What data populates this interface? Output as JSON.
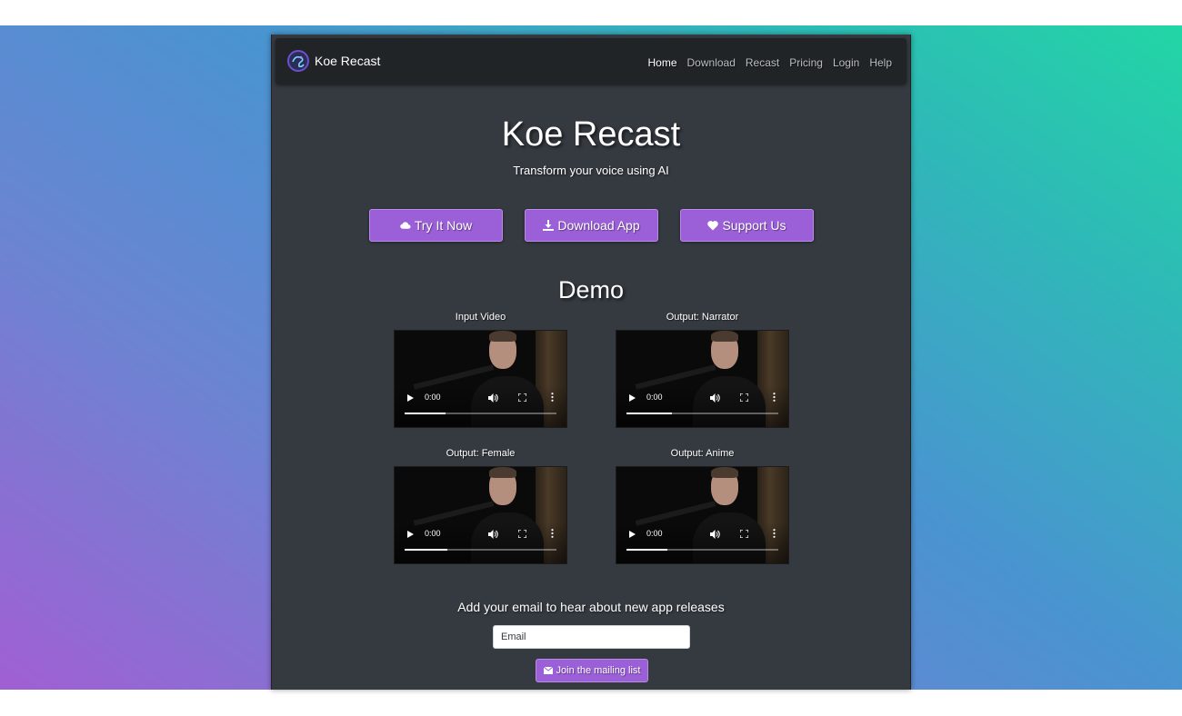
{
  "brand": {
    "name": "Koe Recast",
    "logo": "koe-logo-icon"
  },
  "nav": {
    "items": [
      {
        "label": "Home",
        "active": true
      },
      {
        "label": "Download",
        "active": false
      },
      {
        "label": "Recast",
        "active": false
      },
      {
        "label": "Pricing",
        "active": false
      },
      {
        "label": "Login",
        "active": false
      },
      {
        "label": "Help",
        "active": false
      }
    ]
  },
  "hero": {
    "title": "Koe Recast",
    "subtitle": "Transform your voice using AI"
  },
  "actions": {
    "try_label": "Try It Now",
    "try_icon": "cloud-icon",
    "download_label": "Download App",
    "download_icon": "download-icon",
    "support_label": "Support Us",
    "support_icon": "heart-icon"
  },
  "demo": {
    "title": "Demo",
    "videos": [
      {
        "caption": "Input Video",
        "time": "0:00",
        "progress": 0.27
      },
      {
        "caption": "Output: Narrator",
        "time": "0:00",
        "progress": 0.3
      },
      {
        "caption": "Output: Female",
        "time": "0:00",
        "progress": 0.28
      },
      {
        "caption": "Output: Anime",
        "time": "0:00",
        "progress": 0.27
      }
    ]
  },
  "mailing": {
    "heading": "Add your email to hear about new app releases",
    "email_placeholder": "Email",
    "email_value": "",
    "join_label": "Join the mailing list",
    "join_icon": "envelope-icon"
  },
  "colors": {
    "accent": "#9b5fd8",
    "panel": "#343a40",
    "navbar": "#212427"
  }
}
